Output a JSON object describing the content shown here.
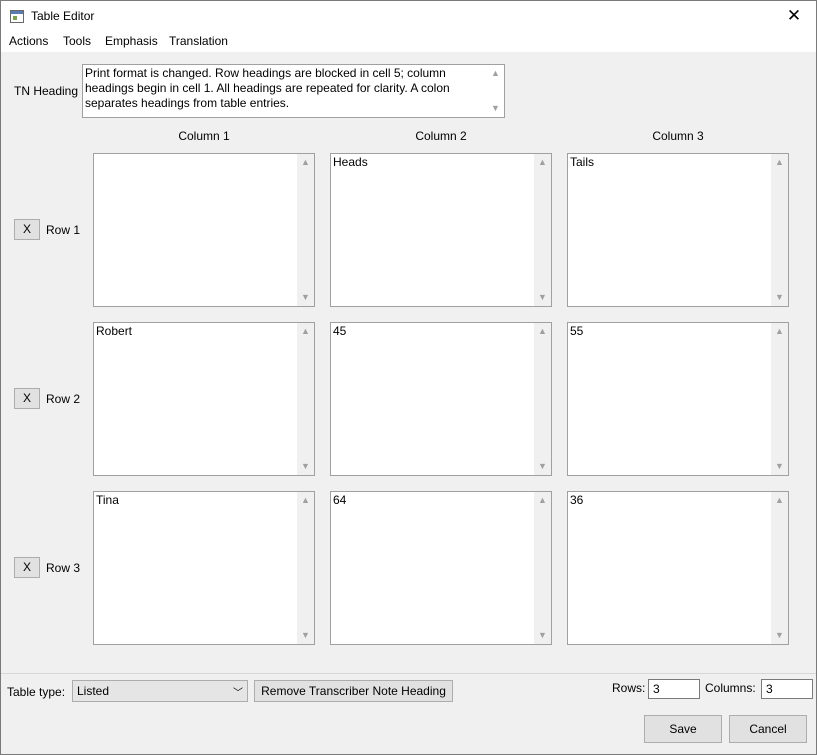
{
  "window": {
    "title": "Table Editor",
    "close_glyph": "✕"
  },
  "menu": [
    "Actions",
    "Tools",
    "Emphasis",
    "Translation"
  ],
  "tn_heading": {
    "label": "TN Heading",
    "text": "Print format is changed. Row headings are blocked in cell 5; column headings begin in cell 1. All headings are repeated for clarity. A colon separates headings from table entries."
  },
  "columns": [
    "Column 1",
    "Column 2",
    "Column 3"
  ],
  "rows": [
    {
      "delete_label": "X",
      "label": "Row 1",
      "cells": [
        "",
        "Heads",
        "Tails"
      ]
    },
    {
      "delete_label": "X",
      "label": "Row 2",
      "cells": [
        "Robert",
        "45",
        "55"
      ]
    },
    {
      "delete_label": "X",
      "label": "Row 3",
      "cells": [
        "Tina",
        "64",
        "36"
      ]
    }
  ],
  "footer": {
    "table_type_label": "Table type:",
    "table_type_value": "Listed",
    "remove_button": "Remove Transcriber Note Heading",
    "rows_label": "Rows:",
    "rows_value": "3",
    "columns_label": "Columns:",
    "columns_value": "3",
    "save_button": "Save",
    "cancel_button": "Cancel"
  },
  "icons": {
    "scroll_up": "▲",
    "scroll_down": "▼",
    "dropdown": "﹀"
  }
}
